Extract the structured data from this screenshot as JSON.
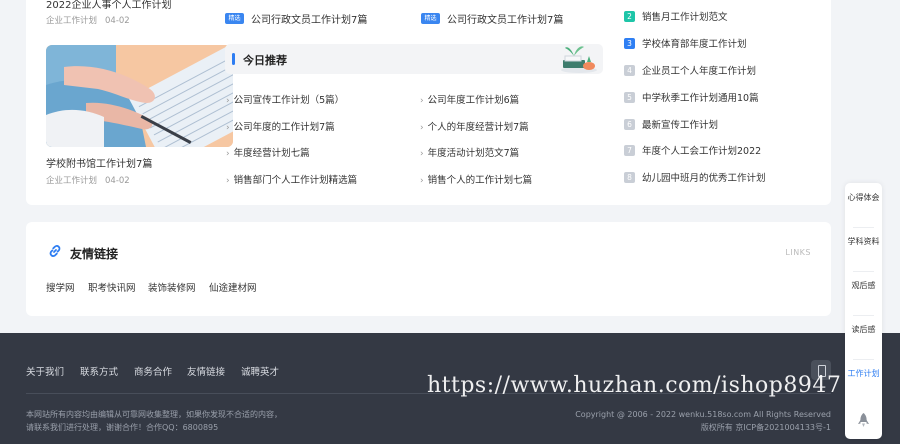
{
  "left": {
    "top_title": "2022企业人事个人工作计划",
    "top_meta": {
      "category": "企业工作计划",
      "date": "04-02"
    },
    "article_title": "学校附书馆工作计划7篇",
    "article_meta": {
      "category": "企业工作计划",
      "date": "04-02"
    }
  },
  "tagged": [
    {
      "badge": "精选",
      "label": "公司行政文员工作计划7篇"
    },
    {
      "badge": "精选",
      "label": "公司行政文员工作计划7篇"
    }
  ],
  "recommend": {
    "title": "今日推荐",
    "links": [
      "公司宣传工作计划（5篇）",
      "公司年度工作计划6篇",
      "公司年度的工作计划7篇",
      "个人的年度经营计划7篇",
      "年度经营计划七篇",
      "年度活动计划范文7篇",
      "销售部门个人工作计划精选篇",
      "销售个人的工作计划七篇"
    ]
  },
  "ranking": [
    {
      "num": "2",
      "label": "销售月工作计划范文"
    },
    {
      "num": "3",
      "label": "学校体育部年度工作计划"
    },
    {
      "num": "4",
      "label": "企业员工个人年度工作计划"
    },
    {
      "num": "5",
      "label": "中学秋季工作计划通用10篇"
    },
    {
      "num": "6",
      "label": "最新宣传工作计划"
    },
    {
      "num": "7",
      "label": "年度个人工会工作计划2022"
    },
    {
      "num": "8",
      "label": "幼儿园中班月的优秀工作计划"
    }
  ],
  "friend_links": {
    "title": "友情链接",
    "en": "LINKS",
    "items": [
      "搜学网",
      "职考快讯网",
      "装饰装修网",
      "仙途建材网"
    ]
  },
  "footer": {
    "nav": [
      "关于我们",
      "联系方式",
      "商务合作",
      "友情链接",
      "诚聘英才"
    ],
    "notice_line1": "本网站所有内容均由编辑从可靠网收集整理，如果你发现不合适的内容，",
    "notice_line2": "请联系我们进行处理，谢谢合作！合作QQ：6800895",
    "copyright": "Copyright @ 2006 - 2022 wenku.518so.com All Rights Reserved",
    "icp": "版权所有    京ICP备2021004133号-1"
  },
  "float_bar": {
    "items": [
      "心得体会",
      "学科资料",
      "观后感",
      "读后感",
      "工作计划"
    ]
  },
  "watermark": "https://www.huzhan.com/ishop8947",
  "colors": {
    "accent": "#2d7df2",
    "footer_bg": "#343944",
    "rank_teal": "#1ec5a8"
  }
}
